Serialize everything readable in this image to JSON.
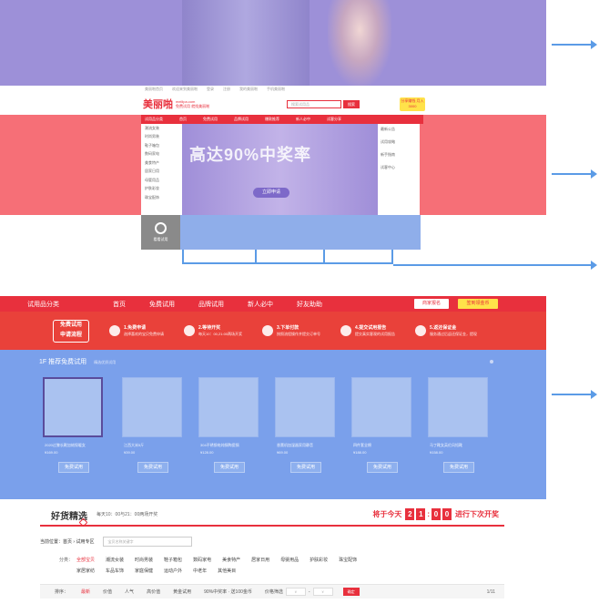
{
  "top_header": {
    "links": [
      "美丽啪首页",
      "欢迎来到美丽啪",
      "登录",
      "注册",
      "我的美丽啪",
      "手机美丽啪"
    ],
    "logo": "美丽啪",
    "logo_sub": "meilipa.com",
    "logo_tagline": "免费试用 就找美丽啪",
    "search_placeholder": "搜索试用品",
    "search_button": "搜索",
    "promo": "分享赚钱 月入3000"
  },
  "small_nav": [
    "试用品分类",
    "首页",
    "免费试用",
    "品牌试用",
    "爆款推荐",
    "新人必中",
    "试客分享"
  ],
  "small_categories": [
    "潮流女装",
    "时尚男装",
    "鞋子箱包",
    "数码家电",
    "美食特产",
    "居家日用",
    "母婴用品",
    "护肤彩妆",
    "珠宝配饰"
  ],
  "banner": {
    "headline": "高达90%中奖率",
    "cta": "立即申请"
  },
  "right_panel": [
    "最新公告",
    "试用攻略",
    "新手指南",
    "试客中心"
  ],
  "history": {
    "label": "看看试用"
  },
  "nav2": {
    "category": "试用品分类",
    "items": [
      "首页",
      "免费试用",
      "品牌试用",
      "新人必中",
      "好友助助"
    ],
    "btn_report": "商家报名",
    "btn_gold": "签到领金币"
  },
  "steps": {
    "title_line1": "免费试用",
    "title_line2": "申请流程",
    "items": [
      {
        "title": "1.免费申请",
        "desc": "选择喜欢的宝贝免费申请"
      },
      {
        "title": "2.等待开奖",
        "desc": "每天10：00,21:00两场开奖"
      },
      {
        "title": "3.下单付款",
        "desc": "按照流程操作并提交订单号"
      },
      {
        "title": "4.提交试用报告",
        "desc": "提交真实客观的试用报告"
      },
      {
        "title": "5.返还保证金",
        "desc": "服务通过后返还保证金，提现"
      }
    ]
  },
  "floor": {
    "title": "1F 推荐免费试用",
    "subtitle": "精选优质试用",
    "products": [
      {
        "name": "2020过膝长靴加绒保暖女",
        "price": "¥169.00",
        "button": "免费试用"
      },
      {
        "name": "江西大米5斤",
        "price": "¥39.00",
        "button": "免费试用"
      },
      {
        "name": "304不锈钢电炖锅陶瓷锅",
        "price": "¥128.00",
        "button": "免费试用"
      },
      {
        "name": "香薰机加湿器家用静音",
        "price": "¥69.00",
        "button": "免费试用"
      },
      {
        "name": "四件套全棉",
        "price": "¥188.00",
        "button": "免费试用"
      },
      {
        "name": "马丁靴女英伦风短靴",
        "price": "¥158.00",
        "button": "免费试用"
      }
    ]
  },
  "good": {
    "title": "好货精选",
    "subtitle": "每天10：00与21：00两场开奖",
    "countdown_prefix": "将于今天",
    "digits": [
      "2",
      "1",
      "0",
      "0"
    ],
    "countdown_suffix": "进行下次开奖",
    "crumb_label": "当前位置：",
    "crumb_path": "首页 › 试用专区",
    "crumb_placeholder": "宝贝名称关键字",
    "category_label": "分类：",
    "cat_row1": [
      "全部宝贝",
      "潮流女装",
      "时尚男装",
      "鞋子箱包",
      "数码家电",
      "美食特产",
      "居家日用",
      "母婴用品",
      "护肤彩妆",
      "珠宝配饰"
    ],
    "cat_row2": [
      "家居家纺",
      "车品车饰",
      "家庭保健",
      "运动户外",
      "中老年",
      "其他美目"
    ],
    "sort_label": "排序：",
    "sort_items": [
      "最新",
      "价值",
      "人气",
      "高价值",
      "黄金试用",
      "90%中奖率 · 送100金币"
    ],
    "price_filter": "价格筛选",
    "price_from": "¥",
    "price_to": "¥",
    "confirm": "确定",
    "page": "1/11"
  }
}
